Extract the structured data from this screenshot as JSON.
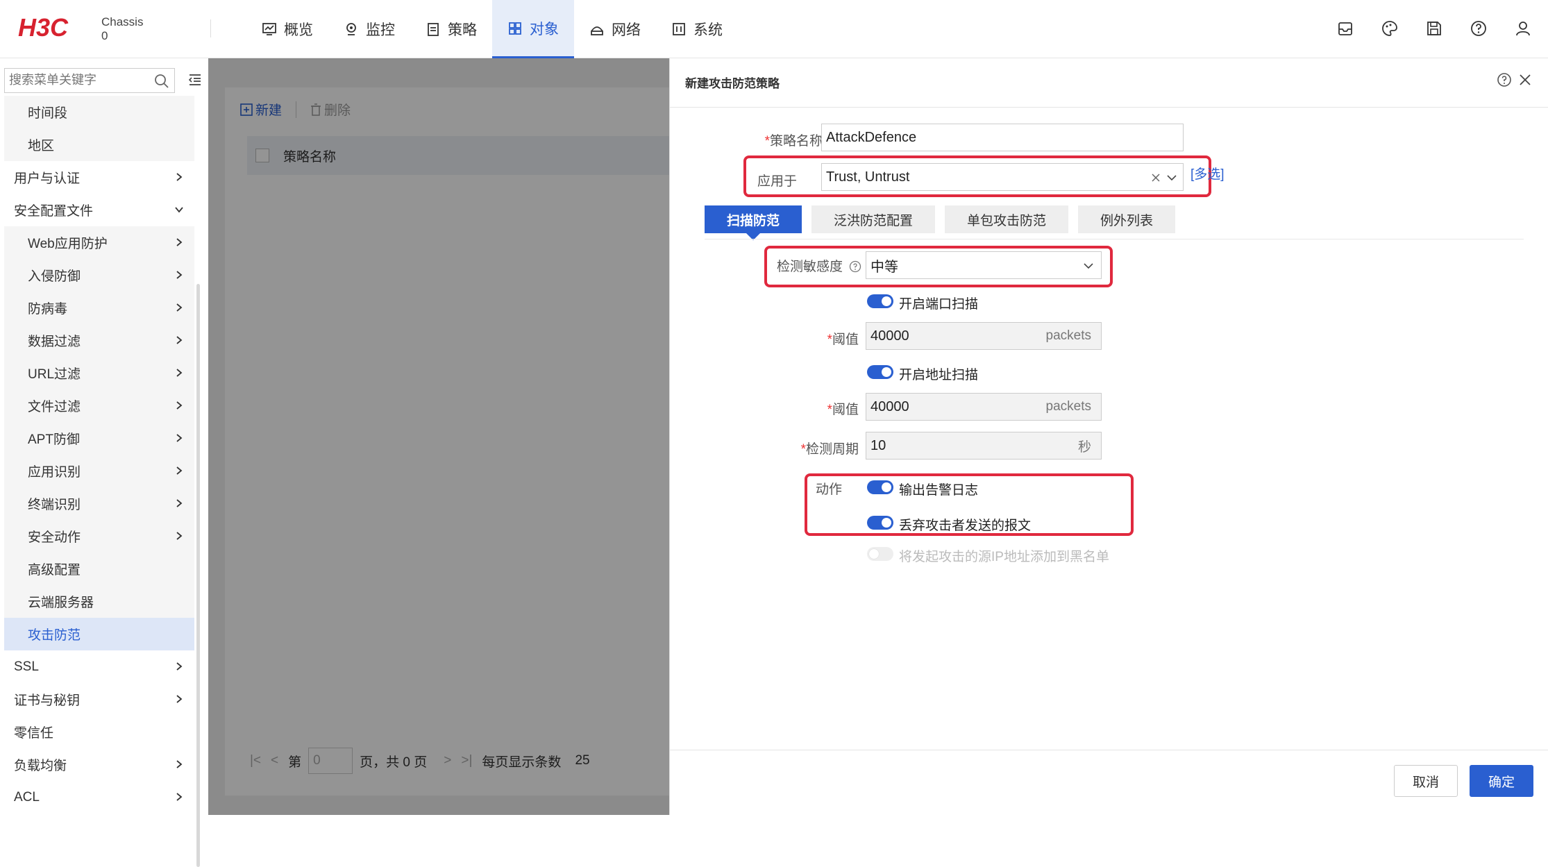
{
  "header": {
    "logo_text": "H3C",
    "chassis_label": "Chassis",
    "chassis_value": "0",
    "nav": [
      {
        "label": "概览",
        "icon": "overview-icon"
      },
      {
        "label": "监控",
        "icon": "monitor-icon"
      },
      {
        "label": "策略",
        "icon": "policy-icon"
      },
      {
        "label": "对象",
        "icon": "object-icon",
        "active": true
      },
      {
        "label": "网络",
        "icon": "network-icon"
      },
      {
        "label": "系统",
        "icon": "system-icon"
      }
    ],
    "icons": [
      "inbox-icon",
      "palette-icon",
      "save-icon",
      "help-icon",
      "user-icon"
    ]
  },
  "sidebar": {
    "search_placeholder": "搜索菜单关键字",
    "items": [
      {
        "label": "时间段",
        "level": 2,
        "chevron": false
      },
      {
        "label": "地区",
        "level": 2,
        "chevron": false
      },
      {
        "label": "用户与认证",
        "level": 1,
        "chevron": "right"
      },
      {
        "label": "安全配置文件",
        "level": 1,
        "chevron": "down"
      },
      {
        "label": "Web应用防护",
        "level": 2,
        "chevron": "right"
      },
      {
        "label": "入侵防御",
        "level": 2,
        "chevron": "right"
      },
      {
        "label": "防病毒",
        "level": 2,
        "chevron": "right"
      },
      {
        "label": "数据过滤",
        "level": 2,
        "chevron": "right"
      },
      {
        "label": "URL过滤",
        "level": 2,
        "chevron": "right"
      },
      {
        "label": "文件过滤",
        "level": 2,
        "chevron": "right"
      },
      {
        "label": "APT防御",
        "level": 2,
        "chevron": "right"
      },
      {
        "label": "应用识别",
        "level": 2,
        "chevron": "right"
      },
      {
        "label": "终端识别",
        "level": 2,
        "chevron": "right"
      },
      {
        "label": "安全动作",
        "level": 2,
        "chevron": "right"
      },
      {
        "label": "高级配置",
        "level": 2,
        "chevron": false
      },
      {
        "label": "云端服务器",
        "level": 2,
        "chevron": false
      },
      {
        "label": "攻击防范",
        "level": 2,
        "chevron": false,
        "active": true
      },
      {
        "label": "SSL",
        "level": 1,
        "chevron": "right"
      },
      {
        "label": "证书与秘钥",
        "level": 1,
        "chevron": "right"
      },
      {
        "label": "零信任",
        "level": 1,
        "chevron": false
      },
      {
        "label": "负载均衡",
        "level": 1,
        "chevron": "right"
      },
      {
        "label": "ACL",
        "level": 1,
        "chevron": "right"
      }
    ]
  },
  "main": {
    "toolbar_new": "新建",
    "toolbar_delete": "删除",
    "col_policy_name": "策略名称",
    "pager_page_prefix": "第",
    "pager_page_input": "0",
    "pager_page_suffix": "页，共 0 页",
    "pager_per_page_label": "每页显示条数",
    "pager_per_page_value": "25"
  },
  "dialog": {
    "title": "新建攻击防范策略",
    "policy_name_label": "策略名称",
    "policy_name_value": "AttackDefence",
    "apply_to_label": "应用于",
    "apply_to_value": "Trust, Untrust",
    "multi_select": "[多选]",
    "tabs": [
      "扫描防范",
      "泛洪防范配置",
      "单包攻击防范",
      "例外列表"
    ],
    "sensitivity_label": "检测敏感度",
    "sensitivity_value": "中等",
    "port_scan_label": "开启端口扫描",
    "threshold_label": "阈值",
    "port_threshold_value": "40000",
    "threshold_unit": "packets",
    "addr_scan_label": "开启地址扫描",
    "addr_threshold_value": "40000",
    "period_label": "检测周期",
    "period_value": "10",
    "period_unit": "秒",
    "action_label": "动作",
    "action_log_label": "输出告警日志",
    "action_drop_label": "丢弃攻击者发送的报文",
    "blacklist_label": "将发起攻击的源IP地址添加到黑名单",
    "cancel_button": "取消",
    "ok_button": "确定"
  },
  "colors": {
    "accent": "#2a5fd0",
    "highlight_box": "#e0293e",
    "brand_red": "#d7222f"
  }
}
